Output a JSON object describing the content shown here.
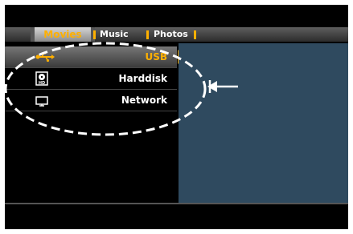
{
  "tabs": [
    {
      "label": "Movies",
      "active": true
    },
    {
      "label": "Music",
      "active": false
    },
    {
      "label": "Photos",
      "active": false
    }
  ],
  "sources": [
    {
      "label": "USB",
      "icon": "usb-icon",
      "selected": true
    },
    {
      "label": "Harddisk",
      "icon": "harddisk-icon",
      "selected": false
    },
    {
      "label": "Network",
      "icon": "network-icon",
      "selected": false
    }
  ],
  "colors": {
    "accent": "#ffb000",
    "panel": "#2f4a5f",
    "annotation": "#ffffff"
  }
}
